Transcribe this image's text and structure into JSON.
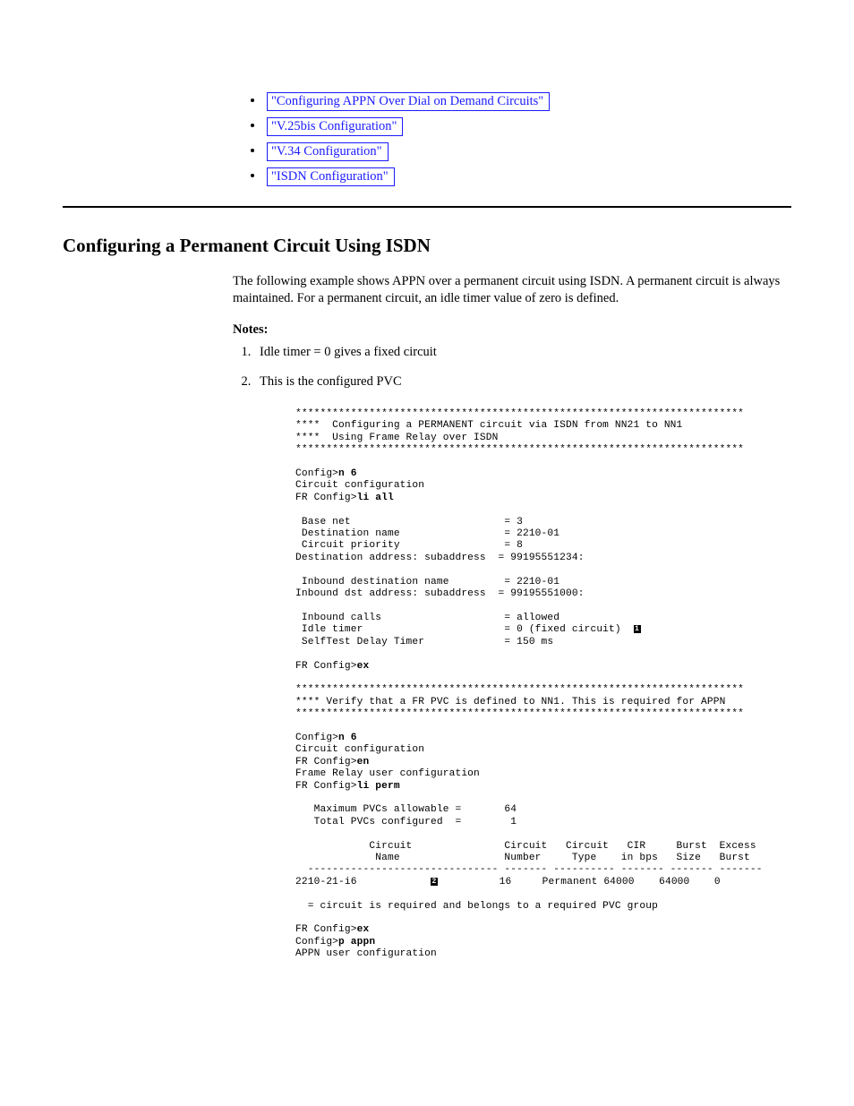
{
  "toc": {
    "items": [
      "\"Configuring APPN Over Dial on Demand Circuits\"",
      "\"V.25bis Configuration\"",
      "\"V.34 Configuration\"",
      "\"ISDN Configuration\""
    ]
  },
  "section": {
    "title": "Configuring a Permanent Circuit Using ISDN",
    "para1": "The following example shows APPN over a permanent circuit using ISDN. A permanent circuit is always maintained. For a permanent circuit, an idle timer value of zero is defined.",
    "notes_intro": "Notes:",
    "notes": [
      "Idle timer = 0 gives a fixed circuit",
      "This is the configured PVC"
    ]
  },
  "terminal": {
    "block1_stars": "*************************************************************************",
    "block1_l1": "****  Configuring a PERMANENT circuit via ISDN from NN21 to NN1",
    "block1_l2": "****  Using Frame Relay over ISDN",
    "cfg_n6": "Config>",
    "cfg_n6_cmd": "n 6",
    "circ_conf": "Circuit configuration",
    "fr_cfg": "FR Config>",
    "li_all": "li all",
    "base_net": " Base net                         = 3",
    "dest_name": " Destination name                 = 2210-01",
    "circ_prio": " Circuit priority                 = 8",
    "dest_addr": "Destination address: subaddress  = 99195551234:",
    "in_dest_name": " Inbound destination name         = 2210-01",
    "in_dest_addr": "Inbound dst address: subaddress  = 99195551000:",
    "in_calls": " Inbound calls                    = allowed",
    "idle_timer": " Idle timer                       = 0 (fixed circuit)  ",
    "selftest": " SelfTest Delay Timer             = 150 ms",
    "ex": "ex",
    "block2_l1": "**** Verify that a FR PVC is defined to NN1. This is required for APPN",
    "en": "en",
    "fr_user_conf": "Frame Relay user configuration",
    "li_perm": "li perm",
    "max_pvc": "   Maximum PVCs allowable =       64",
    "total_pvc": "   Total PVCs configured  =        1",
    "hdr1": "            Circuit               Circuit   Circuit   CIR     Burst  Excess",
    "hdr2": "             Name                 Number     Type    in bps   Size   Burst",
    "hdr_rule": "  ------------------------------- ------- ---------- ------- ------- -------",
    "row_pre": "2210-21-i6            ",
    "row_post": "          16     Permanent 64000    64000    0",
    "footnote": "  = circuit is required and belongs to a required PVC group",
    "p_appn": "p appn",
    "appn_user": "APPN user configuration"
  }
}
